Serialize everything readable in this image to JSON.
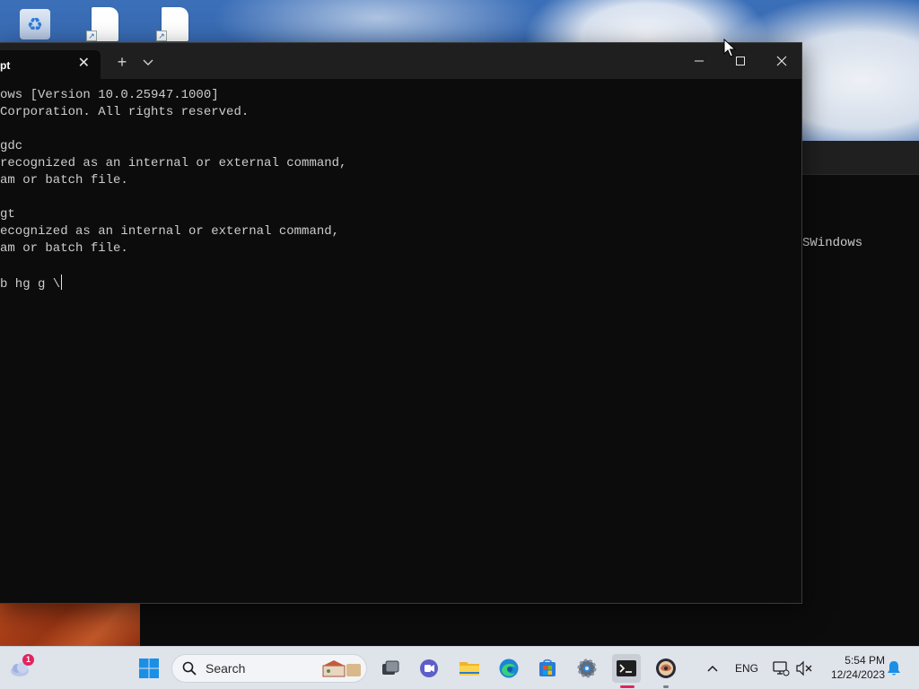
{
  "desktop": {
    "icons": [
      {
        "name": "recycle-bin-icon"
      },
      {
        "name": "document-shortcut-icon"
      },
      {
        "name": "document-shortcut-icon"
      }
    ]
  },
  "background_window": {
    "visible_text": "SWindows"
  },
  "terminal": {
    "tab_label": "pt",
    "tab_close": "✕",
    "new_tab": "+",
    "lines": [
      "ows [Version 10.0.25947.1000]",
      "Corporation. All rights reserved.",
      "",
      "gdc",
      "recognized as an internal or external command,",
      "am or batch file.",
      "",
      "gt",
      "ecognized as an internal or external command,",
      "am or batch file.",
      "",
      "b hg g \\"
    ]
  },
  "taskbar": {
    "weather_badge": "1",
    "search_label": "Search",
    "language": "ENG",
    "clock_time": "5:54 PM",
    "clock_date": "12/24/2023",
    "accent_color": "#e0245e"
  }
}
